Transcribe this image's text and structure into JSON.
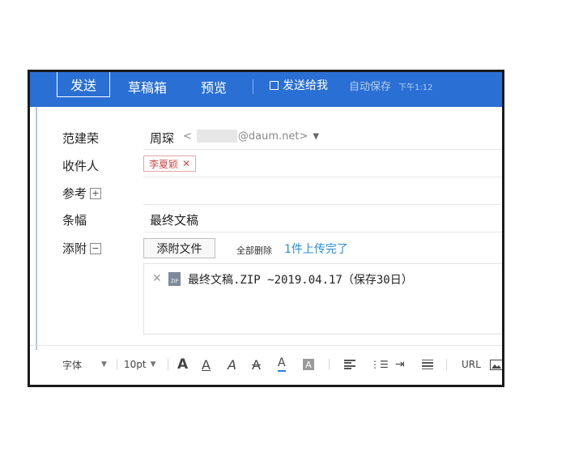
{
  "toolbar": {
    "send": "发送",
    "drafts": "草稿箱",
    "preview": "预览",
    "send_to_me": "发送给我",
    "autosave": "自动保存",
    "autosave_time": "下午1:12"
  },
  "form": {
    "from_label": "范建荣",
    "from_name": "周琛",
    "from_addr_prefix": "<",
    "from_addr_domain": "@daum.net>",
    "to_label": "收件人",
    "recipient": "李夏颖",
    "cc_label": "参考",
    "subject_label": "条幅",
    "subject": "最终文稿",
    "attach_label": "添附",
    "attach_button": "添附文件",
    "delete_all": "全部删除",
    "upload_status": "1件上传完了",
    "file": "最终文稿.ZIP ~2019.04.17（保存30日）"
  },
  "editor": {
    "font": "字体",
    "size": "10pt",
    "url": "URL"
  },
  "icons": {
    "zip": "zip-file-icon",
    "remove": "close-icon"
  },
  "colors": {
    "toolbar": "#2a6fd4",
    "tag_red": "#d34a4a",
    "link_blue": "#2a8bd4"
  }
}
